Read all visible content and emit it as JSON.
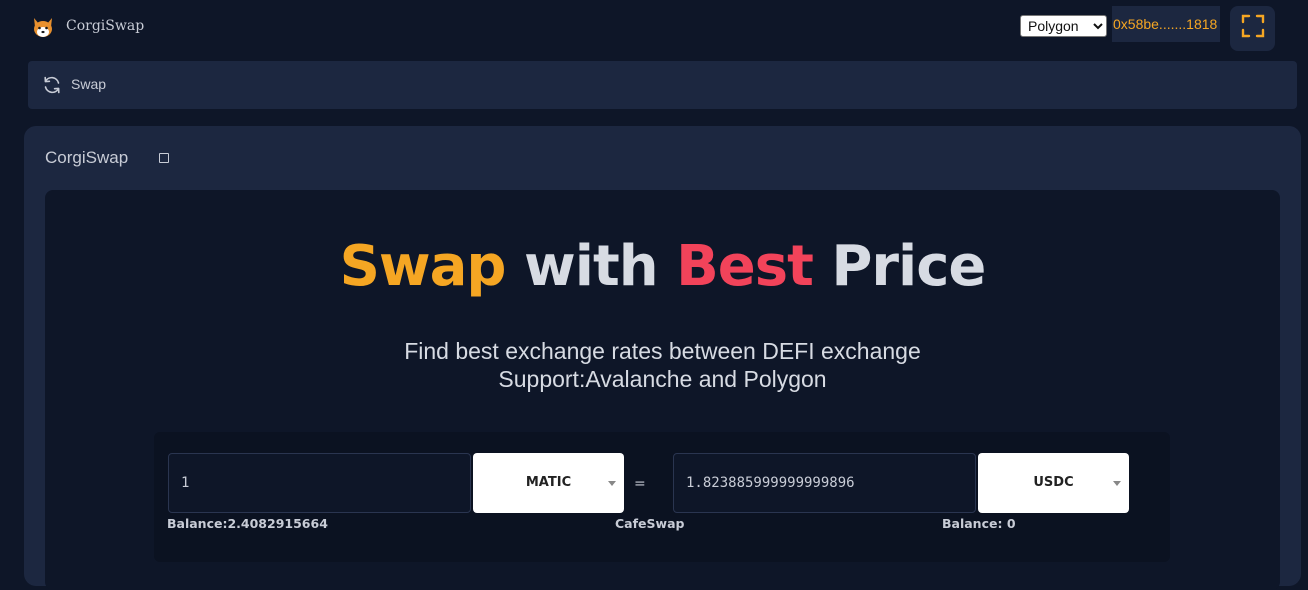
{
  "app": {
    "brand": "CorgiSwap",
    "logo_icon": "corgi-logo-icon"
  },
  "header": {
    "network": {
      "selected": "Polygon",
      "options": [
        "Polygon"
      ]
    },
    "wallet_address": "0x58be.......1818",
    "fullscreen_icon": "fullscreen-icon",
    "accent_color": "#f5a623"
  },
  "nav": {
    "items": [
      {
        "label": "Swap",
        "icon": "refresh-icon"
      }
    ]
  },
  "panel": {
    "title": "CorgiSwap",
    "checkbox_icon": "square-icon"
  },
  "hero": {
    "words": [
      {
        "text": "Swap",
        "color": "#f5a623"
      },
      {
        "text": "with",
        "color": "#d7dbe3"
      },
      {
        "text": "Best",
        "color": "#f2435a"
      },
      {
        "text": "Price",
        "color": "#d7dbe3"
      }
    ],
    "subtitle_line1": "Find best exchange rates between DEFI exchange",
    "subtitle_line2": "Support:Avalanche and Polygon"
  },
  "swap": {
    "from": {
      "amount": "1",
      "token": "MATIC",
      "balance_label": "Balance:2.4082915664"
    },
    "equals_sign": "=",
    "exchange_label": "CafeSwap",
    "to": {
      "amount": "1.823885999999999896",
      "token": "USDC",
      "balance_label": "Balance: 0"
    }
  }
}
